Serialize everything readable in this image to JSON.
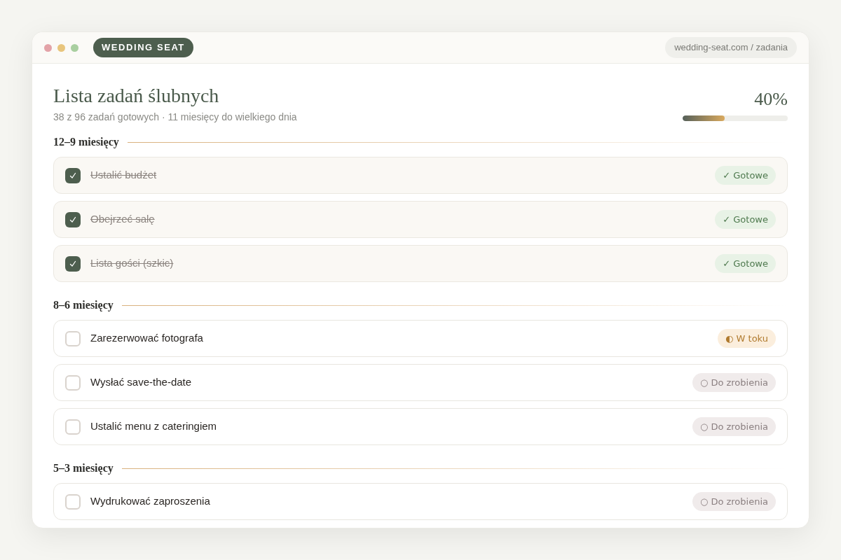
{
  "window": {
    "brand": "WEDDING SEAT",
    "url": "wedding-seat.com / zadania"
  },
  "header": {
    "title": "Lista zadań ślubnych",
    "subtitle": "38 z 96 zadań gotowych · 11 miesięcy do wielkiego dnia",
    "percent": "40%",
    "level": 0.4
  },
  "sections": [
    {
      "title": "12–9 miesięcy",
      "tasks": [
        {
          "label": "Ustalić budżet",
          "checked": true,
          "kind": "done",
          "badge": "✓ Gotowe"
        },
        {
          "label": "Obejrzeć salę",
          "checked": true,
          "kind": "done",
          "badge": "✓ Gotowe"
        },
        {
          "label": "Lista gości (szkic)",
          "checked": true,
          "kind": "done",
          "badge": "✓ Gotowe"
        }
      ]
    },
    {
      "title": "8–6 miesięcy",
      "tasks": [
        {
          "label": "Zarezerwować fotografa",
          "checked": false,
          "kind": "in_progress",
          "badge": "◐ W toku"
        },
        {
          "label": "Wysłać save-the-date",
          "checked": false,
          "kind": "todo",
          "badge": "○ Do zrobienia"
        },
        {
          "label": "Ustalić menu z cateringiem",
          "checked": false,
          "kind": "todo",
          "badge": "○ Do zrobienia"
        }
      ]
    },
    {
      "title": "5–3 miesięcy",
      "tasks": [
        {
          "label": "Wydrukować zaproszenia",
          "checked": false,
          "kind": "todo",
          "badge": "○ Do zrobienia"
        }
      ]
    }
  ]
}
